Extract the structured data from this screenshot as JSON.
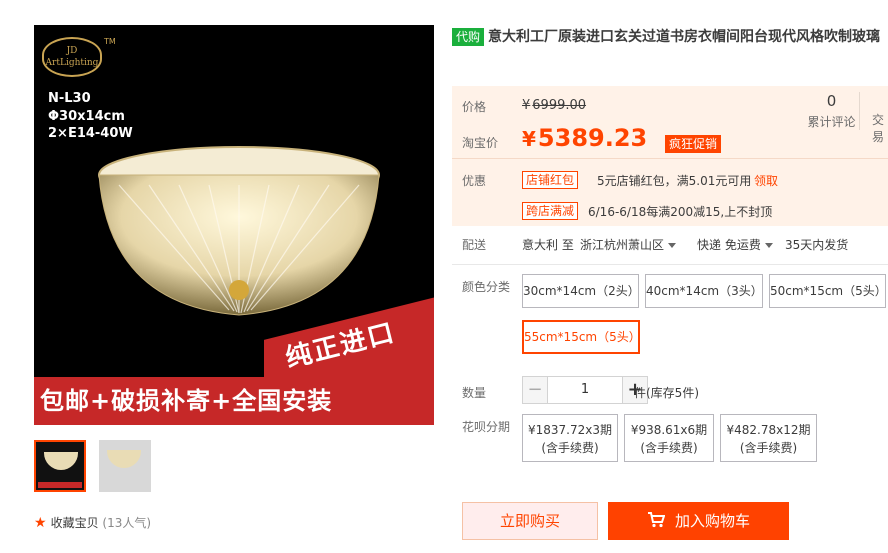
{
  "gallery": {
    "logo_text": "JD ArtLighting",
    "tm": "TM",
    "spec_model": "N-L30",
    "spec_size": "Φ30x14cm",
    "spec_bulb": "2×E14-40W",
    "badge": "纯正进口",
    "banner": "包邮+破损补寄+全国安装"
  },
  "favorite": {
    "label": "收藏宝贝",
    "count": "(13人气)"
  },
  "product": {
    "tag": "代购",
    "title": "意大利工厂原装进口玄关过道书房衣帽间阳台现代风格吹制玻璃"
  },
  "price": {
    "original_label": "价格",
    "original_currency": "¥",
    "original_value": "6999.00",
    "taobao_label": "淘宝价",
    "taobao_currency": "¥",
    "taobao_value": "5389.23",
    "promo_badge": "疯狂促销",
    "reviews_count": "0",
    "reviews_label": "累计评论",
    "deals_label": "交易"
  },
  "offers": {
    "label": "优惠",
    "shop_tag": "店铺红包",
    "shop_text": "5元店铺红包，满5.01元可用",
    "shop_link": "领取",
    "cross_tag": "跨店满减",
    "cross_text": "6/16-6/18每满200减15,上不封顶"
  },
  "delivery": {
    "label": "配送",
    "from": "意大利 至",
    "to": "浙江杭州萧山区",
    "shipping": "快递 免运费",
    "dispatch": "35天内发货"
  },
  "options": {
    "label": "颜色分类",
    "items": [
      "30cm*14cm（2头）",
      "40cm*14cm（3头）",
      "50cm*15cm（5头）",
      "55cm*15cm（5头）"
    ]
  },
  "quantity": {
    "label": "数量",
    "minus": "−",
    "value": "1",
    "plus": "+",
    "stock": "件(库存5件)"
  },
  "installments": {
    "label": "花呗分期",
    "plans": [
      {
        "amount": "¥1837.72x3期",
        "fee": "(含手续费)"
      },
      {
        "amount": "¥938.61x6期",
        "fee": "(含手续费)"
      },
      {
        "amount": "¥482.78x12期",
        "fee": "(含手续费)"
      }
    ]
  },
  "actions": {
    "buy_now": "立即购买",
    "add_cart": "加入购物车"
  },
  "colors": {
    "accent": "#ff4400",
    "price_bg": "#fff2e8",
    "tag_green": "#1aaf3c",
    "banner_red": "#c62828"
  }
}
